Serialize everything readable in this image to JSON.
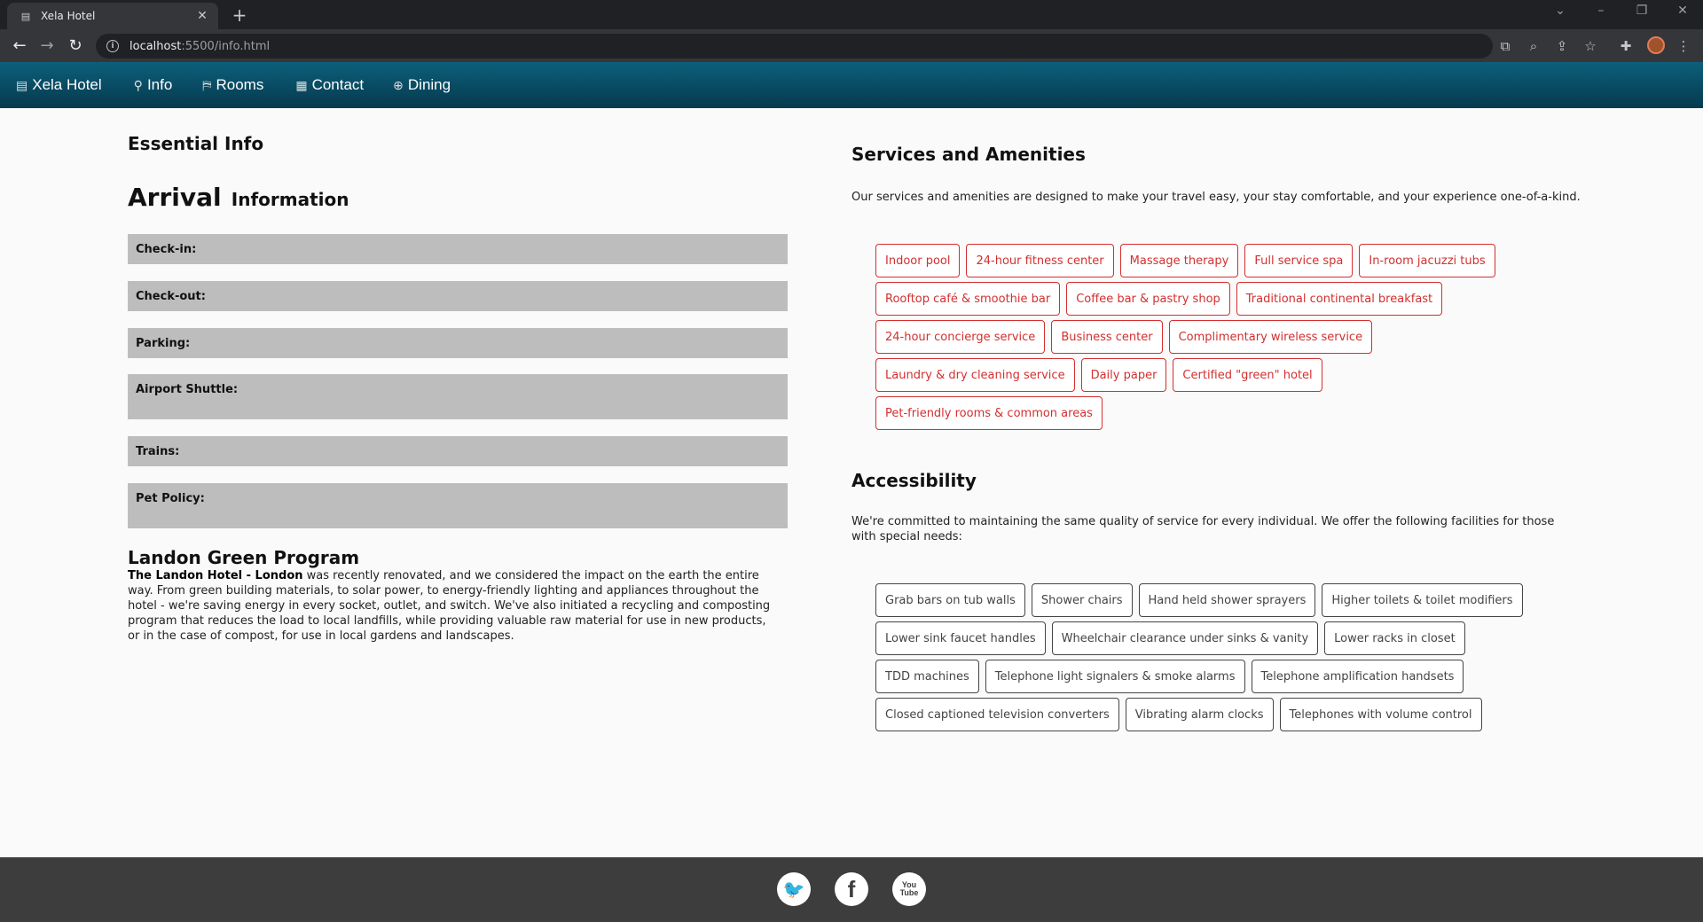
{
  "browser": {
    "tab_title": "Xela Hotel",
    "new_tab_glyph": "+",
    "url_host": "localhost",
    "url_rest": ":5500/info.html",
    "icons": [
      "back-arrow-icon",
      "forward-arrow-icon",
      "reload-icon",
      "translate-icon",
      "zoom-icon",
      "share-icon",
      "star-icon",
      "extensions-icon",
      "menu-icon"
    ]
  },
  "nav": {
    "brand": "Xela Hotel",
    "items": [
      {
        "label": "Info",
        "icon": "info-icon"
      },
      {
        "label": "Rooms",
        "icon": "bed-icon"
      },
      {
        "label": "Contact",
        "icon": "contact-icon"
      },
      {
        "label": "Dining",
        "icon": "dining-icon"
      }
    ]
  },
  "left": {
    "essential_title": "Essential Info",
    "arrival_big": "Arrival",
    "arrival_small": "Information",
    "rows": [
      {
        "label": "Check-in:"
      },
      {
        "label": "Check-out:"
      },
      {
        "label": "Parking:"
      },
      {
        "label": "Airport Shuttle:"
      },
      {
        "label": "Trains:"
      },
      {
        "label": "Pet Policy:"
      }
    ],
    "green_title": "Landon Green Program",
    "green_bold": "The Landon Hotel - London",
    "green_text": " was recently renovated, and we considered the impact on the earth the entire way. From green building materials, to solar power, to energy-friendly lighting and appliances throughout the hotel - we're saving energy in every socket, outlet, and switch. We've also initiated a recycling and composting program that reduces the load to local landfills, while providing valuable raw material for use in new products, or in the case of compost, for use in local gardens and landscapes."
  },
  "right": {
    "services_title": "Services and Amenities",
    "services_intro": "Our services and amenities are designed to make your travel easy, your stay comfortable, and your experience one-of-a-kind.",
    "services_rows": [
      [
        "Indoor pool",
        "24-hour fitness center",
        "Massage therapy",
        "Full service spa",
        "In-room jacuzzi tubs"
      ],
      [
        "Rooftop café & smoothie bar",
        "Coffee bar & pastry shop",
        "Traditional continental breakfast"
      ],
      [
        "24-hour concierge service",
        "Business center",
        "Complimentary wireless service"
      ],
      [
        "Laundry & dry cleaning service",
        "Daily paper",
        "Certified \"green\" hotel"
      ],
      [
        "Pet-friendly rooms & common areas"
      ]
    ],
    "access_title": "Accessibility",
    "access_intro": "We're committed to maintaining the same quality of service for every individual. We offer the following facilities for those with special needs:",
    "access_rows": [
      [
        "Grab bars on tub walls",
        "Shower chairs",
        "Hand held shower sprayers",
        "Higher toilets & toilet modifiers"
      ],
      [
        "Lower sink faucet handles",
        "Wheelchair clearance under sinks & vanity",
        "Lower racks in closet"
      ],
      [
        "TDD machines",
        "Telephone light signalers & smoke alarms",
        "Telephone amplification handsets"
      ],
      [
        "Closed captioned television converters",
        "Vibrating alarm clocks",
        "Telephones with volume control"
      ]
    ]
  },
  "footer": {
    "social": [
      {
        "name": "twitter-icon",
        "glyph": "🐦"
      },
      {
        "name": "facebook-icon",
        "glyph": "f"
      },
      {
        "name": "youtube-icon",
        "glyph": "You Tube"
      }
    ]
  },
  "colors": {
    "nav_top": "#0d5f7b",
    "nav_bottom": "#053a4e",
    "service_tag": "#d32f2f",
    "access_tag": "#444444",
    "info_row_bg": "#bdbdbd",
    "footer_bg": "#3d3d3d"
  }
}
